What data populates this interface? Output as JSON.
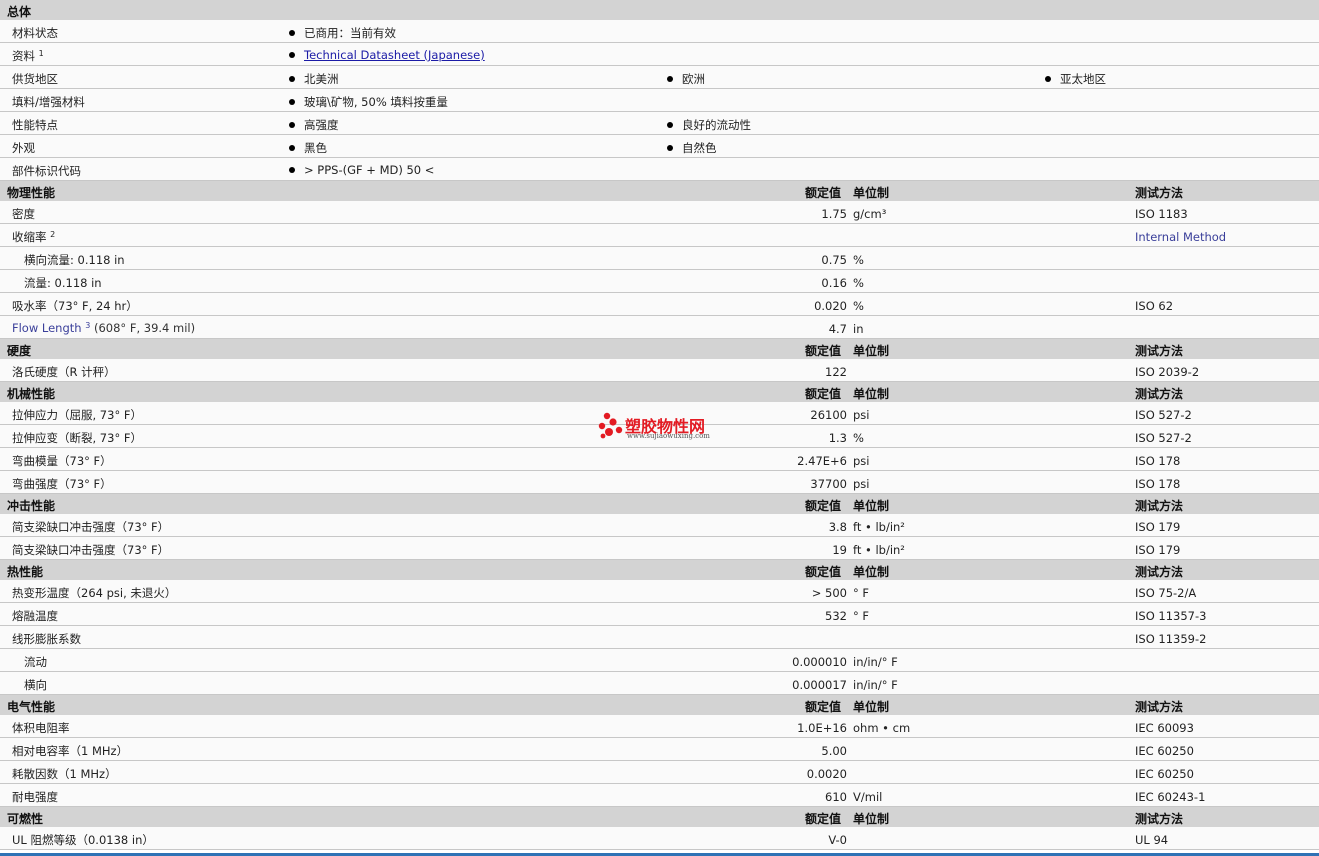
{
  "general": {
    "title": "总体",
    "rows": [
      {
        "label": "材料状态",
        "items": [
          "已商用：当前有效"
        ]
      },
      {
        "label": "资料",
        "sup": "1",
        "items": [
          "Technical Datasheet (Japanese)"
        ]
      },
      {
        "label": "供货地区",
        "items": [
          "北美洲",
          "欧洲",
          "亚太地区"
        ]
      },
      {
        "label": "填料/增强材料",
        "items": [
          "玻璃\\矿物, 50% 填料按重量"
        ]
      },
      {
        "label": "性能特点",
        "items": [
          "高强度",
          "良好的流动性"
        ]
      },
      {
        "label": "外观",
        "items": [
          "黑色",
          "自然色"
        ]
      },
      {
        "label": "部件标识代码",
        "items": [
          "> PPS-(GF + MD) 50 <"
        ]
      }
    ]
  },
  "headers": {
    "nominal": "额定值",
    "unit": "单位制",
    "method": "测试方法"
  },
  "physical": {
    "title": "物理性能",
    "rows": [
      {
        "label": "密度",
        "value": "1.75",
        "unit": "g/cm³",
        "method": "ISO 1183"
      },
      {
        "label": "收缩率",
        "sup": "2",
        "value": "",
        "unit": "",
        "method": "Internal Method"
      },
      {
        "label": "横向流量: 0.118 in",
        "value": "0.75",
        "unit": "%",
        "method": ""
      },
      {
        "label": "流量: 0.118 in",
        "value": "0.16",
        "unit": "%",
        "method": ""
      },
      {
        "label": "吸水率（73° F, 24 hr）",
        "value": "0.020",
        "unit": "%",
        "method": "ISO 62"
      },
      {
        "label": "Flow Length",
        "sup": "3",
        "label_tail": "(608° F, 39.4 mil)",
        "value": "4.7",
        "unit": "in",
        "method": ""
      }
    ]
  },
  "hardness": {
    "title": "硬度",
    "rows": [
      {
        "label": "洛氏硬度（R 计秤）",
        "value": "122",
        "unit": "",
        "method": "ISO 2039-2"
      }
    ]
  },
  "mechanical": {
    "title": "机械性能",
    "rows": [
      {
        "label": "拉伸应力（屈服, 73° F）",
        "value": "26100",
        "unit": "psi",
        "method": "ISO 527-2"
      },
      {
        "label": "拉伸应变（断裂, 73° F）",
        "value": "1.3",
        "unit": "%",
        "method": "ISO 527-2"
      },
      {
        "label": "弯曲模量（73° F）",
        "value": "2.47E+6",
        "unit": "psi",
        "method": "ISO 178"
      },
      {
        "label": "弯曲强度（73° F）",
        "value": "37700",
        "unit": "psi",
        "method": "ISO 178"
      }
    ]
  },
  "impact": {
    "title": "冲击性能",
    "rows": [
      {
        "label": "简支梁缺口冲击强度（73° F）",
        "value": "3.8",
        "unit": "ft • lb/in²",
        "method": "ISO 179"
      },
      {
        "label": "简支梁缺口冲击强度（73° F）",
        "value": "19",
        "unit": "ft • lb/in²",
        "method": "ISO 179"
      }
    ]
  },
  "thermal": {
    "title": "热性能",
    "rows": [
      {
        "label": "热变形温度（264 psi, 未退火）",
        "value": "> 500",
        "unit": "° F",
        "method": "ISO 75-2/A"
      },
      {
        "label": "熔融温度",
        "value": "532",
        "unit": "° F",
        "method": "ISO 11357-3"
      },
      {
        "label": "线形膨胀系数",
        "value": "",
        "unit": "",
        "method": "ISO 11359-2"
      },
      {
        "label": "流动",
        "value": "0.000010",
        "unit": "in/in/° F",
        "method": ""
      },
      {
        "label": "横向",
        "value": "0.000017",
        "unit": "in/in/° F",
        "method": ""
      }
    ]
  },
  "electrical": {
    "title": "电气性能",
    "rows": [
      {
        "label": "体积电阻率",
        "value": "1.0E+16",
        "unit": "ohm • cm",
        "method": "IEC 60093"
      },
      {
        "label": "相对电容率（1 MHz）",
        "value": "5.00",
        "unit": "",
        "method": "IEC 60250"
      },
      {
        "label": "耗散因数（1 MHz）",
        "value": "0.0020",
        "unit": "",
        "method": "IEC 60250"
      },
      {
        "label": "耐电强度",
        "value": "610",
        "unit": "V/mil",
        "method": "IEC 60243-1"
      }
    ]
  },
  "flammability": {
    "title": "可燃性",
    "rows": [
      {
        "label": "UL 阻燃等级（0.0138 in）",
        "value": "V-0",
        "unit": "",
        "method": "UL 94"
      }
    ]
  },
  "watermark": {
    "name": "塑胶物性网",
    "url": "www.sujiaowuxing.com",
    "color": "#e31b23"
  }
}
